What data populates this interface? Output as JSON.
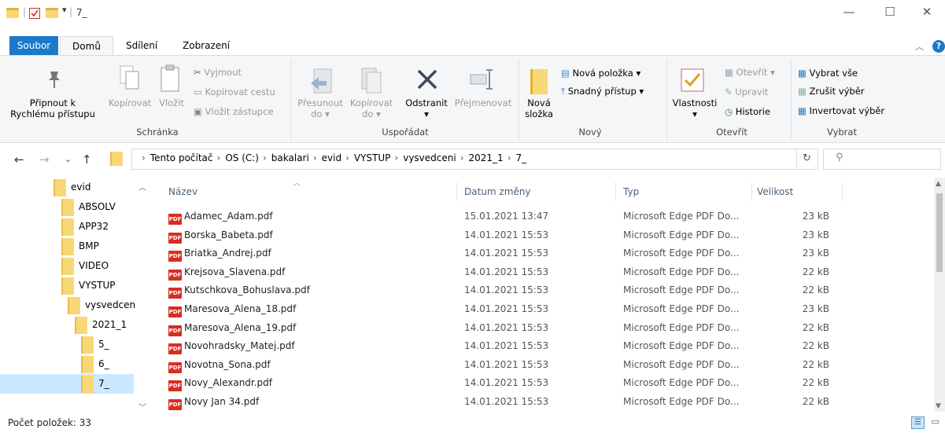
{
  "window": {
    "title": "7_",
    "minimize": "—",
    "maximize": "☐",
    "close": "✕"
  },
  "tabs": [
    "Soubor",
    "Domů",
    "Sdílení",
    "Zobrazení"
  ],
  "ribbon": {
    "schranka": {
      "group_label": "Schránka",
      "pin_line1": "Připnout k",
      "pin_line2": "Rychlému přístupu",
      "copy": "Kopírovat",
      "paste": "Vložit",
      "cut": "Vyjmout",
      "copy_path": "Kopírovat cestu",
      "paste_shortcut": "Vložit zástupce"
    },
    "usporadat": {
      "group_label": "Uspořádat",
      "move_line1": "Přesunout",
      "move_line2": "do",
      "copyto_line1": "Kopírovat",
      "copyto_line2": "do",
      "delete": "Odstranit",
      "rename": "Přejmenovat"
    },
    "novy": {
      "group_label": "Nový",
      "new_folder_line1": "Nová",
      "new_folder_line2": "složka",
      "new_item": "Nová položka",
      "easy_access": "Snadný přístup"
    },
    "otevrit": {
      "group_label": "Otevřít",
      "properties": "Vlastnosti",
      "open": "Otevřít",
      "edit": "Upravit",
      "history": "Historie"
    },
    "vybrat": {
      "group_label": "Vybrat",
      "select_all": "Vybrat vše",
      "select_none": "Zrušit výběr",
      "invert": "Invertovat výběr"
    }
  },
  "address": {
    "crumbs": [
      "Tento počítač",
      "OS (C:)",
      "bakalari",
      "evid",
      "VYSTUP",
      "vysvedceni",
      "2021_1",
      "7_"
    ],
    "separator": "›"
  },
  "nav": {
    "items": [
      {
        "label": "evid",
        "indent": 0
      },
      {
        "label": "ABSOLV",
        "indent": 1
      },
      {
        "label": "APP32",
        "indent": 1
      },
      {
        "label": "BMP",
        "indent": 1
      },
      {
        "label": "VIDEO",
        "indent": 1
      },
      {
        "label": "VYSTUP",
        "indent": 1
      },
      {
        "label": "vysvedcen",
        "indent": 2
      },
      {
        "label": "2021_1",
        "indent": 3
      },
      {
        "label": "5_",
        "indent": 4
      },
      {
        "label": "6_",
        "indent": 4
      },
      {
        "label": "7_",
        "indent": 4
      }
    ]
  },
  "columns": {
    "name": "Název",
    "date": "Datum změny",
    "type": "Typ",
    "size": "Velikost"
  },
  "files": [
    {
      "name": "Adamec_Adam.pdf",
      "date": "15.01.2021 13:47",
      "type": "Microsoft Edge PDF Do...",
      "size": "23 kB"
    },
    {
      "name": "Borska_Babeta.pdf",
      "date": "14.01.2021 15:53",
      "type": "Microsoft Edge PDF Do...",
      "size": "23 kB"
    },
    {
      "name": "Briatka_Andrej.pdf",
      "date": "14.01.2021 15:53",
      "type": "Microsoft Edge PDF Do...",
      "size": "23 kB"
    },
    {
      "name": "Krejsova_Slavena.pdf",
      "date": "14.01.2021 15:53",
      "type": "Microsoft Edge PDF Do...",
      "size": "22 kB"
    },
    {
      "name": "Kutschkova_Bohuslava.pdf",
      "date": "14.01.2021 15:53",
      "type": "Microsoft Edge PDF Do...",
      "size": "22 kB"
    },
    {
      "name": "Maresova_Alena_18.pdf",
      "date": "14.01.2021 15:53",
      "type": "Microsoft Edge PDF Do...",
      "size": "23 kB"
    },
    {
      "name": "Maresova_Alena_19.pdf",
      "date": "14.01.2021 15:53",
      "type": "Microsoft Edge PDF Do...",
      "size": "22 kB"
    },
    {
      "name": "Novohradsky_Matej.pdf",
      "date": "14.01.2021 15:53",
      "type": "Microsoft Edge PDF Do...",
      "size": "22 kB"
    },
    {
      "name": "Novotna_Sona.pdf",
      "date": "14.01.2021 15:53",
      "type": "Microsoft Edge PDF Do...",
      "size": "22 kB"
    },
    {
      "name": "Novy_Alexandr.pdf",
      "date": "14.01.2021 15:53",
      "type": "Microsoft Edge PDF Do...",
      "size": "22 kB"
    },
    {
      "name": "Novy Jan 34.pdf",
      "date": "14.01.2021 15:53",
      "type": "Microsoft Edge PDF Do...",
      "size": "22 kB"
    }
  ],
  "pdf_badge": "PDF",
  "status": {
    "items_count": "Počet položek: 33"
  },
  "colors": {
    "accent": "#1979ca",
    "ribbon_bg": "#f5f6f7",
    "folder": "#f8d775",
    "selected": "#cce8ff",
    "pdf": "#d92d20"
  }
}
